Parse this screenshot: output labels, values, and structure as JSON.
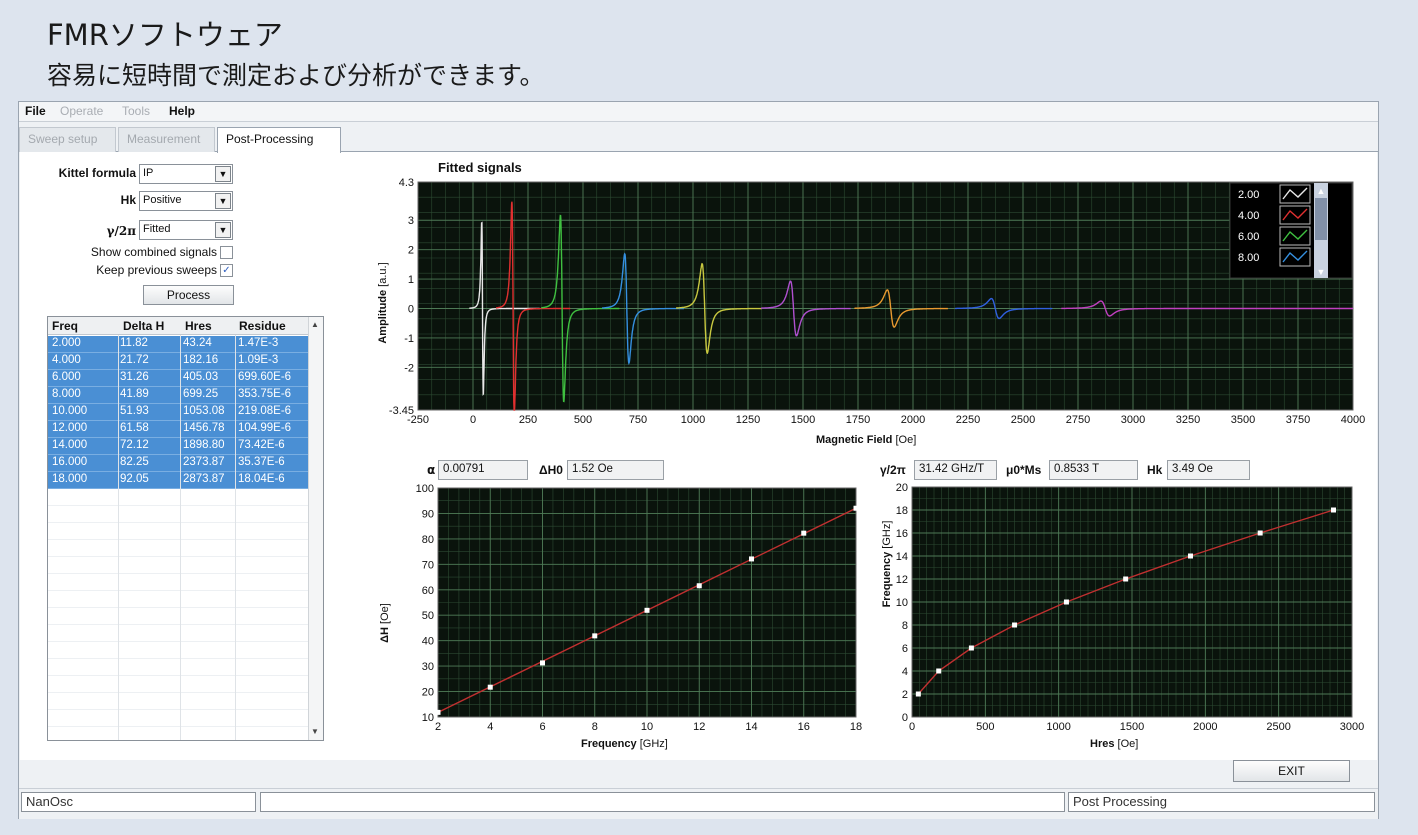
{
  "header": {
    "title": "FMRソフトウェア",
    "subtitle": "容易に短時間で測定および分析ができます。"
  },
  "menu": [
    {
      "label": "File",
      "enabled": true
    },
    {
      "label": "Operate",
      "enabled": false
    },
    {
      "label": "Tools",
      "enabled": false
    },
    {
      "label": "Help",
      "enabled": true
    }
  ],
  "tabs": [
    {
      "label": "Sweep setup",
      "active": false
    },
    {
      "label": "Measurement",
      "active": false
    },
    {
      "label": "Post-Processing",
      "active": true
    }
  ],
  "controls": {
    "kittel_label": "Kittel formula",
    "kittel_value": "IP",
    "hk_label": "Hk",
    "hk_value": "Positive",
    "gamma_label": "γ/2π",
    "gamma_value": "Fitted",
    "show_combined_label": "Show combined signals",
    "show_combined_checked": false,
    "keep_prev_label": "Keep previous sweeps",
    "keep_prev_checked": true,
    "process_label": "Process"
  },
  "table": {
    "headers": [
      "Freq",
      "Delta H",
      "Hres",
      "Residue"
    ],
    "rows": [
      [
        "2.000",
        "11.82",
        "43.24",
        "1.47E-3"
      ],
      [
        "4.000",
        "21.72",
        "182.16",
        "1.09E-3"
      ],
      [
        "6.000",
        "31.26",
        "405.03",
        "699.60E-6"
      ],
      [
        "8.000",
        "41.89",
        "699.25",
        "353.75E-6"
      ],
      [
        "10.000",
        "51.93",
        "1053.08",
        "219.08E-6"
      ],
      [
        "12.000",
        "61.58",
        "1456.78",
        "104.99E-6"
      ],
      [
        "14.000",
        "72.12",
        "1898.80",
        "73.42E-6"
      ],
      [
        "16.000",
        "82.25",
        "2373.87",
        "35.37E-6"
      ],
      [
        "18.000",
        "92.05",
        "2873.87",
        "18.04E-6"
      ]
    ]
  },
  "params": {
    "alpha_label": "α",
    "alpha_value": "0.00791",
    "dh0_label": "ΔH0",
    "dh0_value": "1.52 Oe",
    "gamma_label": "γ/2π",
    "gamma_value": "31.42 GHz/T",
    "ms_label": "μ0*Ms",
    "ms_value": "0.8533 T",
    "hk_label": "Hk",
    "hk_value": "3.49 Oe"
  },
  "chart_data": [
    {
      "type": "line",
      "title": "Fitted signals",
      "xlabel": "Magnetic Field",
      "xunit": "[Oe]",
      "ylabel": "Amplitude",
      "yunit": "[a.u.]",
      "xlim": [
        -250,
        4000
      ],
      "ylim": [
        -3.45,
        4.3
      ],
      "xticks": [
        "-250",
        "0",
        "250",
        "500",
        "750",
        "1000",
        "1250",
        "1500",
        "1750",
        "2000",
        "2250",
        "2500",
        "2750",
        "3000",
        "3250",
        "3500",
        "3750",
        "4000"
      ],
      "yticks": [
        "4.3",
        "3",
        "2",
        "1",
        "0",
        "-1",
        "-2",
        "-3.45"
      ],
      "legend_position": "top-right",
      "series": [
        {
          "name": "2.00",
          "color": "#e8e8e8",
          "hres": 43.24,
          "amp": 3.5
        },
        {
          "name": "4.00",
          "color": "#e03030",
          "hres": 182.16,
          "amp": 4.3
        },
        {
          "name": "6.00",
          "color": "#3fc040",
          "hres": 405.03,
          "amp": 3.75
        },
        {
          "name": "8.00",
          "color": "#3590e0",
          "hres": 699.25,
          "amp": 2.2
        },
        {
          "color": "#c8c840",
          "hres": 1053.08,
          "amp": 1.8
        },
        {
          "color": "#b050d0",
          "hres": 1456.78,
          "amp": 1.1
        },
        {
          "color": "#e89a30",
          "hres": 1898.8,
          "amp": 0.75
        },
        {
          "color": "#3060e0",
          "hres": 2373.87,
          "amp": 0.4
        },
        {
          "color": "#c040c0",
          "hres": 2873.87,
          "amp": 0.3
        }
      ]
    },
    {
      "type": "scatter",
      "xlabel": "Frequency",
      "xunit": "[GHz]",
      "ylabel": "ΔH",
      "yunit": "[Oe]",
      "xlim": [
        2,
        18
      ],
      "ylim": [
        10,
        100
      ],
      "xticks": [
        "2",
        "4",
        "6",
        "8",
        "10",
        "12",
        "14",
        "16",
        "18"
      ],
      "yticks": [
        "100",
        "90",
        "80",
        "70",
        "60",
        "50",
        "40",
        "30",
        "20",
        "10"
      ],
      "x": [
        2,
        4,
        6,
        8,
        10,
        12,
        14,
        16,
        18
      ],
      "y": [
        11.82,
        21.72,
        31.26,
        41.89,
        51.93,
        61.58,
        72.12,
        82.25,
        92.05
      ],
      "fit_color": "#c03030"
    },
    {
      "type": "scatter",
      "xlabel": "Hres",
      "xunit": "[Oe]",
      "ylabel": "Frequency",
      "yunit": "[GHz]",
      "xlim": [
        0,
        3000
      ],
      "ylim": [
        0,
        20
      ],
      "xticks": [
        "0",
        "500",
        "1000",
        "1500",
        "2000",
        "2500",
        "3000"
      ],
      "yticks": [
        "20",
        "18",
        "16",
        "14",
        "12",
        "10",
        "8",
        "6",
        "4",
        "2",
        "0"
      ],
      "x": [
        43.24,
        182.16,
        405.03,
        699.25,
        1053.08,
        1456.78,
        1898.8,
        2373.87,
        2873.87
      ],
      "y": [
        2,
        4,
        6,
        8,
        10,
        12,
        14,
        16,
        18
      ],
      "fit_color": "#c03030"
    }
  ],
  "status": {
    "brand": "NanOsc",
    "middle": "",
    "right": "Post Processing",
    "exit_label": "EXIT"
  }
}
